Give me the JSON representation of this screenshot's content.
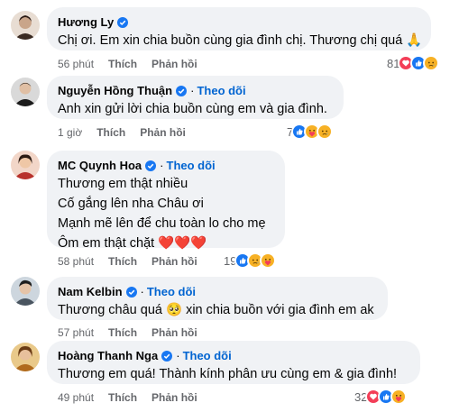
{
  "comments": [
    {
      "author": "Hương Ly",
      "verified": true,
      "follow": "",
      "lines": [
        "Chị ơi. Em xin chia buồn cùng gia đình chị. Thương chị quá 🙏"
      ],
      "time": "56 phút",
      "like": "Thích",
      "reply": "Phản hồi",
      "reaction_count": "81",
      "reactions": [
        "love",
        "like",
        "sad"
      ],
      "avatar_color": "#c9a58a"
    },
    {
      "author": "Nguyễn Hồng Thuận",
      "verified": true,
      "follow": "Theo dõi",
      "lines": [
        "Anh xin gửi lời chia buồn cùng em và gia đình."
      ],
      "time": "1 giờ",
      "like": "Thích",
      "reply": "Phản hồi",
      "reaction_count": "7",
      "reactions": [
        "like",
        "care",
        "sad"
      ],
      "avatar_color": "#2b2b2b"
    },
    {
      "author": "MC Quynh Hoa",
      "verified": true,
      "follow": "Theo dõi",
      "lines": [
        "Thương em thật nhiều",
        "Cố gắng lên nha Châu ơi",
        "Mạnh mẽ lên để chu toàn lo cho mẹ",
        "Ôm em thật chặt ❤️❤️❤️"
      ],
      "time": "58 phút",
      "like": "Thích",
      "reply": "Phản hồi",
      "reaction_count": "19",
      "reactions": [
        "like",
        "sad",
        "care"
      ],
      "avatar_color": "#b8322c"
    },
    {
      "author": "Nam Kelbin",
      "verified": true,
      "follow": "Theo dõi",
      "lines": [
        "Thương châu quá 🥺 xin chia buồn với gia đình em ak"
      ],
      "time": "57 phút",
      "like": "Thích",
      "reply": "Phản hồi",
      "reaction_count": "",
      "reactions": [],
      "avatar_color": "#7a8a96"
    },
    {
      "author": "Hoàng Thanh Nga",
      "verified": true,
      "follow": "Theo dõi",
      "lines": [
        "Thương em quá! Thành kính phân ưu cùng em & gia đình!"
      ],
      "time": "49 phút",
      "like": "Thích",
      "reply": "Phản hồi",
      "reaction_count": "32",
      "reactions": [
        "love",
        "like",
        "care"
      ],
      "avatar_color": "#d69a3a"
    }
  ],
  "colors": {
    "bubble": "#f0f2f5",
    "follow": "#0064d1",
    "meta": "#65676b",
    "like": "#1877f2",
    "love": "#f33e58",
    "sad": "#f7b125"
  }
}
